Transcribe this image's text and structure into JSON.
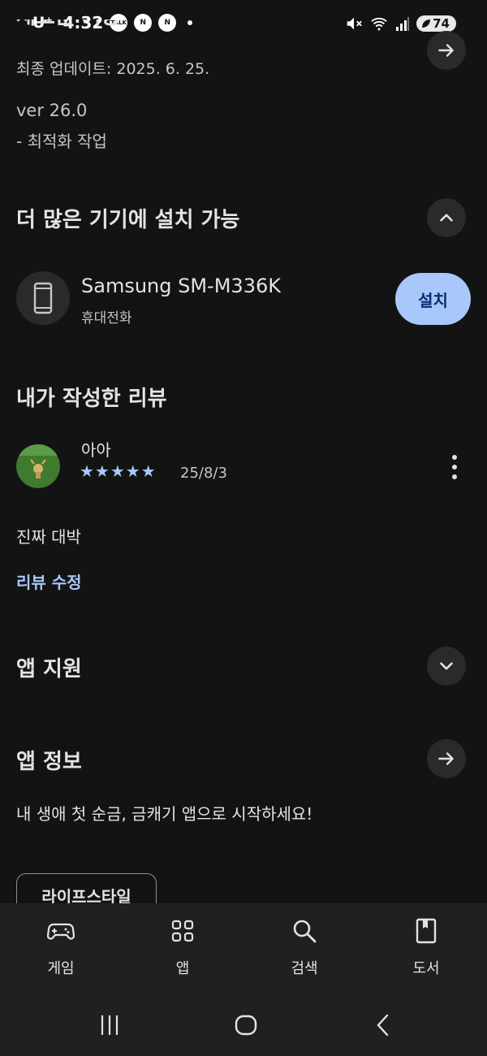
{
  "status_bar": {
    "carrier": "U⁺",
    "time": "4:32",
    "badges": [
      "TALK",
      "N",
      "N"
    ],
    "battery": "74"
  },
  "whats_new": {
    "title_partial": "새로운 기능",
    "last_updated": "최종 업데이트: 2025. 6. 25.",
    "version": "ver 26.0",
    "changelog": "- 최적화 작업"
  },
  "more_devices": {
    "title": "더 많은 기기에 설치 가능",
    "device_name": "Samsung SM-M336K",
    "device_type": "휴대전화",
    "install_label": "설치"
  },
  "my_review": {
    "title": "내가 작성한 리뷰",
    "reviewer_name": "아아",
    "stars": "★★★★★",
    "rating": 5,
    "date": "25/8/3",
    "body": "진짜 대박",
    "edit_label": "리뷰 수정"
  },
  "app_support": {
    "title": "앱 지원"
  },
  "app_info": {
    "title": "앱 정보",
    "description": "내 생애 첫 순금, 금캐기 앱으로 시작하세요!",
    "category_chip": "라이프스타일"
  },
  "bottom_nav": {
    "items": [
      {
        "label": "게임",
        "icon": "gamepad-icon"
      },
      {
        "label": "앱",
        "icon": "apps-grid-icon"
      },
      {
        "label": "검색",
        "icon": "search-icon"
      },
      {
        "label": "도서",
        "icon": "book-icon"
      }
    ]
  },
  "colors": {
    "background": "#131313",
    "accent": "#a8c7fa",
    "install_button_text": "#062e6f"
  }
}
